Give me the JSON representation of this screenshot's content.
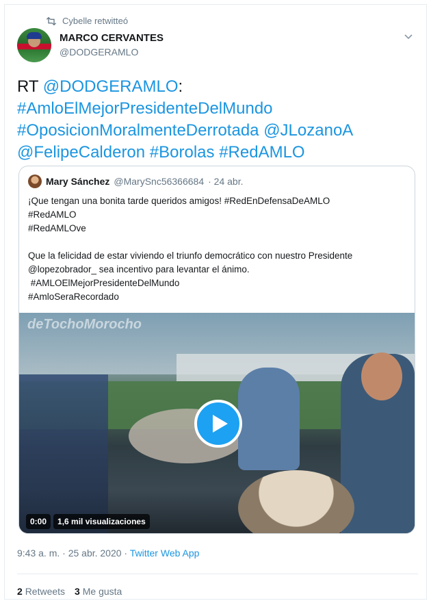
{
  "retweet_line": {
    "label": "Cybelle retwitteó"
  },
  "author": {
    "name": "MARCO CERVANTES",
    "handle": "@DODGERAMLO"
  },
  "tweet": {
    "prefix": "RT ",
    "mention_main": "@DODGERAMLO",
    "colon": ":",
    "hashtag1": "#AmloElMejorPresidenteDelMundo",
    "hashtag2": "#OposicionMoralmenteDerrotada",
    "mention2": "@JLozanoA",
    "mention3": "@FelipeCalderon",
    "hashtag3": "#Borolas",
    "hashtag4": "#RedAMLO"
  },
  "quote": {
    "name": "Mary Sánchez",
    "handle": "@MarySnc56366684",
    "date": "· 24 abr.",
    "lines": [
      "¡Que tengan una bonita tarde queridos amigos! #RedEnDefensaDeAMLO",
      "#RedAMLO",
      "#RedAMLOve",
      "",
      "Que la felicidad de estar viviendo el triunfo democrático con nuestro Presidente",
      "@lopezobrador_  sea  incentivo para levantar el ánimo.",
      " #AMLOElMejorPresidenteDelMundo",
      "#AmloSeraRecordado"
    ],
    "video": {
      "watermark": "deTochoMorocho",
      "time": "0:00",
      "views": "1,6 mil visualizaciones"
    }
  },
  "meta": {
    "time": "9:43 a. m. · 25 abr. 2020 · ",
    "source": "Twitter Web App"
  },
  "stats": {
    "retweets_count": "2",
    "retweets_label": "Retweets",
    "likes_count": "3",
    "likes_label": "Me gusta"
  },
  "colors": {
    "link": "#1b95e0",
    "muted": "#657786",
    "accent": "#1da1f2"
  },
  "icons": {
    "retweet": "retweet-icon",
    "caret": "chevron-down-icon",
    "play": "play-icon"
  }
}
